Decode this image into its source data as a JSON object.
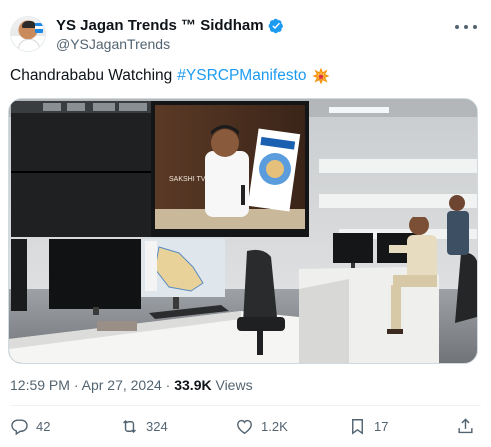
{
  "author": {
    "display_name": "YS Jagan Trends ™ Siddham",
    "handle": "@YSJaganTrends",
    "verified": true,
    "avatar_icon": "profile-avatar"
  },
  "tweet": {
    "text": "Chandrababu Watching ",
    "hashtag": "#YSRCPManifesto",
    "emoji": "collision-icon"
  },
  "media": {
    "screen_label": "SAKSHI TV",
    "description_icon": "photo"
  },
  "meta": {
    "time": "12:59 PM",
    "separator1": " · ",
    "date": "Apr 27, 2024",
    "separator2": " · ",
    "views_count": "33.9K",
    "views_label": " Views"
  },
  "actions": {
    "reply_count": "42",
    "retweet_count": "324",
    "like_count": "1.2K",
    "bookmark_count": "17"
  },
  "colors": {
    "accent": "#1d9bf0",
    "text": "#0f1419",
    "secondary": "#536471",
    "divider": "#eff3f4",
    "verified": "#1d9bf0"
  }
}
